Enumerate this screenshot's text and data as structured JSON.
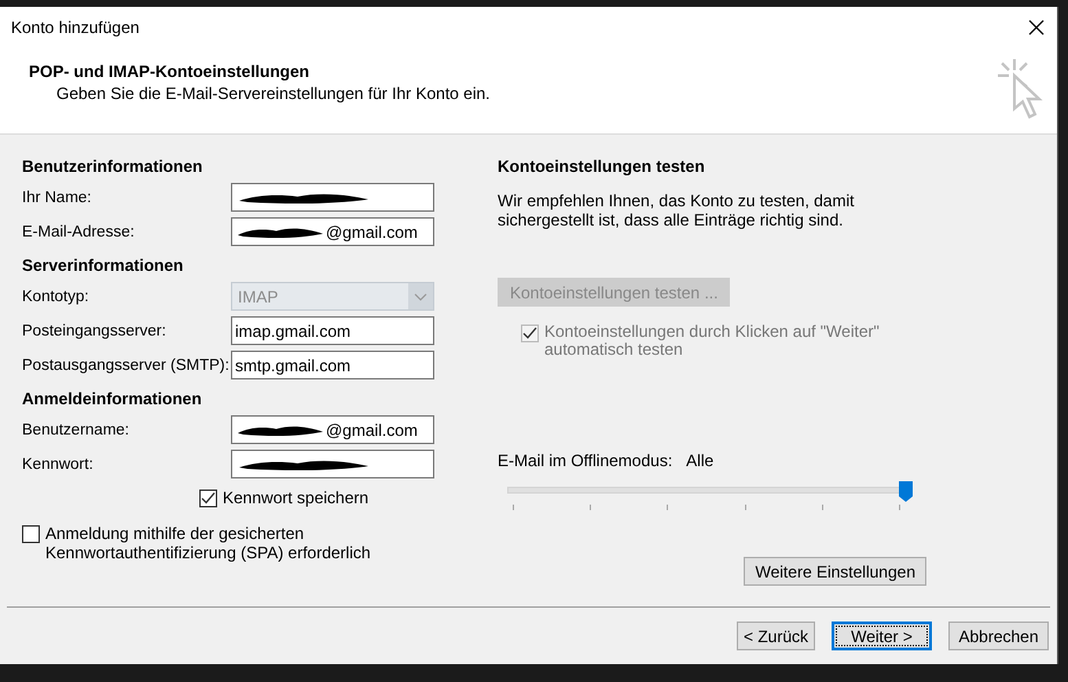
{
  "window": {
    "title": "Konto hinzufügen"
  },
  "header": {
    "title": "POP- und IMAP-Kontoeinstellungen",
    "subtitle": "Geben Sie die E-Mail-Servereinstellungen für Ihr Konto ein."
  },
  "sections": [
    {
      "heading": "Benutzerinformationen",
      "fields": [
        {
          "label": "Ihr Name:",
          "kind": "text",
          "redacted": true
        },
        {
          "label": "E-Mail-Adresse:",
          "kind": "text",
          "value": "@gmail.com",
          "redacted": true
        }
      ]
    },
    {
      "heading": "Serverinformationen",
      "fields": [
        {
          "label": "Kontotyp:",
          "kind": "dropdown",
          "value": "IMAP",
          "disabled": true
        },
        {
          "label": "Posteingangsserver:",
          "kind": "text",
          "value": "imap.gmail.com",
          "redacted": false
        },
        {
          "label": "Postausgangsserver (SMTP):",
          "kind": "text",
          "value": "smtp.gmail.com",
          "redacted": false
        }
      ]
    },
    {
      "heading": "Anmeldeinformationen",
      "fields": [
        {
          "label": "Benutzername:",
          "kind": "text",
          "value": "@gmail.com",
          "redacted": true
        },
        {
          "label": "Kennwort:",
          "kind": "text",
          "redacted": true
        }
      ]
    }
  ],
  "save_password": {
    "label": "Kennwort speichern",
    "checked": true
  },
  "spa": {
    "label": "Anmeldung mithilfe der gesicherten Kennwortauthentifizierung (SPA) erforderlich",
    "checked": false
  },
  "test": {
    "heading": "Kontoeinstellungen testen",
    "description": "Wir empfehlen Ihnen, das Konto zu testen, damit sichergestellt ist, dass alle Einträge richtig sind.",
    "button": {
      "label": "Kontoeinstellungen testen ...",
      "disabled": true
    },
    "auto_test": {
      "label": "Kontoeinstellungen durch Klicken auf \"Weiter\" automatisch testen",
      "checked": true,
      "disabled": true
    }
  },
  "offline": {
    "label": "E-Mail im Offlinemodus:",
    "value": "Alle",
    "level": 1
  },
  "more_settings": "Weitere Einstellungen",
  "buttons": [
    {
      "label": "< Zurück",
      "default": false
    },
    {
      "label": "Weiter >",
      "default": true
    },
    {
      "label": "Abbrechen",
      "default": false
    }
  ]
}
